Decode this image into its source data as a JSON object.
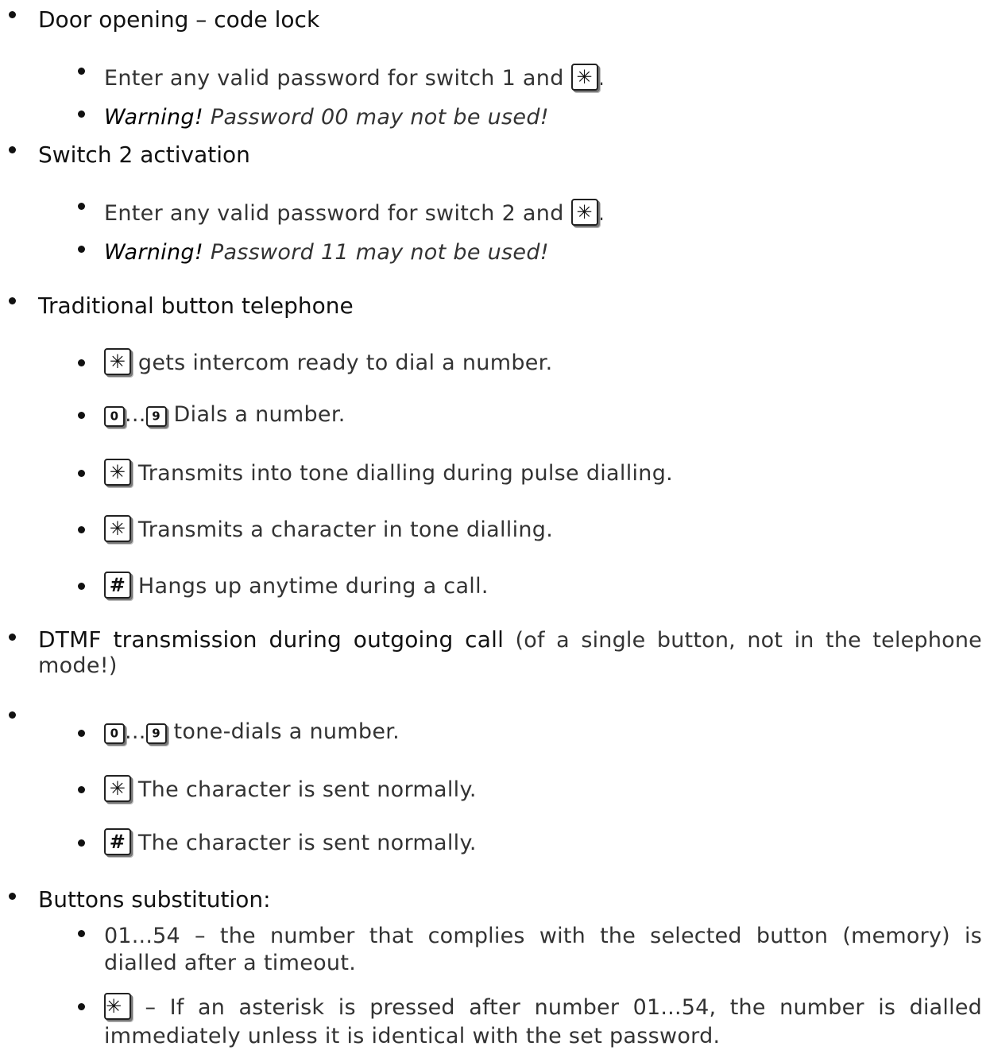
{
  "sections": [
    {
      "heading": "Door opening – code lock",
      "items": [
        {
          "key": "✳",
          "pre": "Enter any valid password for switch 1 and",
          "post": "."
        },
        {
          "warn": "Warning!",
          "text": "Password 00 may not be used!"
        }
      ]
    },
    {
      "heading": "Switch 2 activation",
      "items": [
        {
          "key": "✳",
          "pre": "Enter any valid password for switch 2 and",
          "post": "."
        },
        {
          "warn": "Warning!",
          "text": "Password 11 may not be used!"
        }
      ]
    },
    {
      "heading": "Traditional button telephone",
      "items": [
        {
          "key": "✳",
          "text": "gets intercom ready to dial a number."
        },
        {
          "key1": "0",
          "ellipsis": "...",
          "key2": "9",
          "text": "Dials a number."
        },
        {
          "key": "✳",
          "text": "Transmits into tone dialling during pulse dialling."
        },
        {
          "key": "✳",
          "text": "Transmits a character in tone dialling."
        },
        {
          "key": "#",
          "text": "Hangs up anytime during a call."
        }
      ]
    },
    {
      "heading": "DTMF transmission during outgoing call",
      "note_line1": "(of a single button, not in the telephone",
      "note_line2": "mode!)",
      "items": [
        {
          "key1": "0",
          "ellipsis": "...",
          "key2": "9",
          "text": "tone-dials a number."
        },
        {
          "key": "✳",
          "text": "The character is sent normally."
        },
        {
          "key": "#",
          "text": "The character is sent normally."
        }
      ]
    },
    {
      "heading": "Buttons substitution:",
      "items": [
        {
          "line1": "01...54 – the number that complies with the selected button (memory) is",
          "line2": "dialled after a timeout."
        },
        {
          "key": "✳",
          "line1": "– If an asterisk is pressed after number 01...54, the number is dialled",
          "line2": "immediately unless it is identical with the set password."
        }
      ]
    }
  ]
}
